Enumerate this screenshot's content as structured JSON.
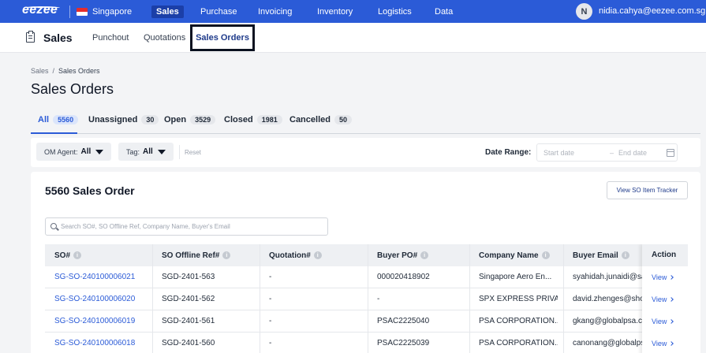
{
  "topnav": {
    "brand": "eezee",
    "country": "Singapore",
    "items": [
      "Sales",
      "Purchase",
      "Invoicing",
      "Inventory",
      "Logistics",
      "Data"
    ],
    "active": "Sales",
    "user_initial": "N",
    "user_email": "nidia.cahya@eezee.com.sg"
  },
  "subnav": {
    "title": "Sales",
    "tabs": [
      "Punchout",
      "Quotations",
      "Sales Orders"
    ],
    "active": "Sales Orders"
  },
  "breadcrumb": [
    "Sales",
    "Sales Orders"
  ],
  "page_title": "Sales Orders",
  "status_tabs": [
    {
      "label": "All",
      "count": "5560"
    },
    {
      "label": "Unassigned",
      "count": "30"
    },
    {
      "label": "Open",
      "count": "3529"
    },
    {
      "label": "Closed",
      "count": "1981"
    },
    {
      "label": "Cancelled",
      "count": "50"
    }
  ],
  "filters": {
    "om_agent_label": "OM Agent:",
    "om_agent_value": "All",
    "tag_label": "Tag:",
    "tag_value": "All",
    "reset": "Reset",
    "date_range_label": "Date Range:",
    "start_placeholder": "Start date",
    "end_placeholder": "End date"
  },
  "card": {
    "title": "5560 Sales Order",
    "tracker_button": "View SO Item Tracker",
    "search_placeholder": "Search SO#, SO Offline Ref, Company Name, Buyer's Email"
  },
  "table": {
    "columns": [
      "SO#",
      "SO Offline Ref#",
      "Quotation#",
      "Buyer PO#",
      "Company Name",
      "Buyer Email"
    ],
    "action_header": "Action",
    "view_label": "View",
    "rows": [
      [
        "SG-SO-240100006021",
        "SGD-2401-563",
        "-",
        "000020418902",
        "Singapore Aero En...",
        "syahidah.junaidi@sa"
      ],
      [
        "SG-SO-240100006020",
        "SGD-2401-562",
        "-",
        "-",
        "SPX EXPRESS PRIVA...",
        "david.zhenges@sho"
      ],
      [
        "SG-SO-240100006019",
        "SGD-2401-561",
        "-",
        "PSAC2225040",
        "PSA CORPORATION...",
        "gkang@globalpsa.co"
      ],
      [
        "SG-SO-240100006018",
        "SGD-2401-560",
        "-",
        "PSAC2225039",
        "PSA CORPORATION...",
        "canonang@globalps"
      ]
    ]
  }
}
